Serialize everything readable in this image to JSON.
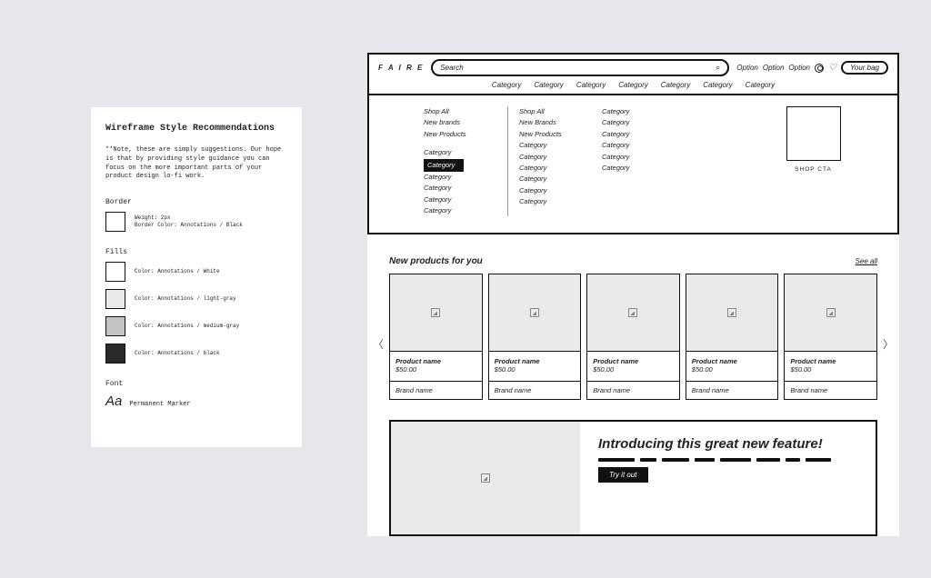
{
  "style_card": {
    "title": "Wireframe Style Recommendations",
    "note": "**Note, these are simply suggestions. Our hope is that by providing style guidance you can focus on the more important parts of your product design lo-fi work.",
    "border_label": "Border",
    "border_weight": "Weight: 2px",
    "border_color": "Border Color: Annotations / Black",
    "fills_label": "Fills",
    "fills": [
      {
        "name": "Color: Annotations / White"
      },
      {
        "name": "Color: Annotations / light-gray"
      },
      {
        "name": "Color: Annotations / medium-gray"
      },
      {
        "name": "Color: Annotations / black"
      }
    ],
    "font_label": "Font",
    "font_sample": "Aa",
    "font_name": "Permanent Marker"
  },
  "nav": {
    "logo": "F A I R E",
    "search_placeholder": "Search",
    "options": [
      "Option",
      "Option",
      "Option"
    ],
    "bag": "Your bag",
    "categories": [
      "Category",
      "Category",
      "Category",
      "Category",
      "Category",
      "Category",
      "Category"
    ]
  },
  "mega": {
    "col1": [
      "Shop All",
      "New brands",
      "New Products",
      "",
      "Category",
      "Category",
      "Category",
      "Category",
      "Category",
      "Category"
    ],
    "col1_highlight_index": 5,
    "col2": [
      "Shop All",
      "New Brands",
      "New Products",
      "Category",
      "Category",
      "Category",
      "Category",
      "Category",
      "Category"
    ],
    "col3": [
      "Category",
      "Category",
      "Category",
      "Category",
      "Category",
      "Category"
    ],
    "shop_cta": "SHOP CTA"
  },
  "products": {
    "title": "New products for you",
    "see_all": "See all",
    "items": [
      {
        "name": "Product name",
        "price": "$50.00",
        "brand": "Brand name"
      },
      {
        "name": "Product name",
        "price": "$50.00",
        "brand": "Brand name"
      },
      {
        "name": "Product name",
        "price": "$50.00",
        "brand": "Brand name"
      },
      {
        "name": "Product name",
        "price": "$50.00",
        "brand": "Brand name"
      },
      {
        "name": "Product name",
        "price": "$50.00",
        "brand": "Brand name"
      }
    ]
  },
  "feature": {
    "title": "Introducing this great new feature!",
    "cta": "Try it out"
  }
}
